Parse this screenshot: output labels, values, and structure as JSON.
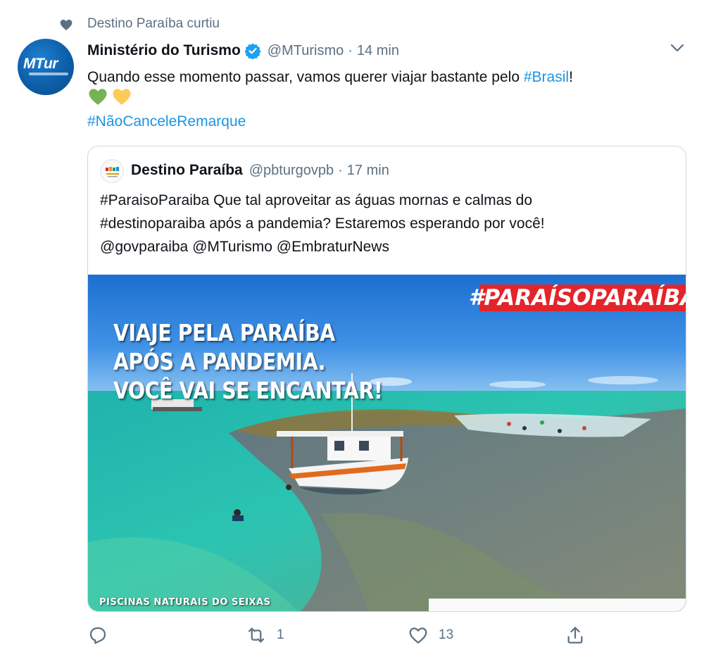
{
  "social_context": {
    "text": "Destino Paraíba curtiu",
    "icon": "heart-icon"
  },
  "tweet": {
    "author_name": "Ministério do Turismo",
    "verified": true,
    "handle": "@MTurismo",
    "separator": "·",
    "time": "14 min",
    "avatar_logo": "MTur",
    "text_prefix": "Quando esse momento passar, vamos querer viajar bastante pelo ",
    "text_link": "#Brasil",
    "text_suffix": "!",
    "emojis": [
      "green-heart",
      "yellow-heart"
    ],
    "hashtag": "#NãoCanceleRemarque"
  },
  "quote": {
    "author_name": "Destino Paraíba",
    "handle": "@pbturgovpb",
    "separator": "·",
    "time": "17 min",
    "text_line1": "#ParaisoParaiba Que tal aproveitar as águas mornas e calmas do",
    "text_line2": "#destinoparaiba após a pandemia? Estaremos esperando por você!",
    "text_line3": "@govparaiba @MTurismo @EmbraturNews",
    "media": {
      "banner": "#PARAÍSOPARAÍBA",
      "headline_line1": "VIAJE PELA PARAÍBA",
      "headline_line2": "APÓS A PANDEMIA.",
      "headline_line3": "VOCÊ VAI SE ENCANTAR!",
      "caption": "PISCINAS NATURAIS DO SEIXAS",
      "banner_color": "#e3242b"
    }
  },
  "actions": {
    "reply_count": "",
    "retweet_count": "1",
    "like_count": "13",
    "share_count": ""
  },
  "colors": {
    "link": "#1b95e0",
    "secondary": "#5b7083",
    "verified": "#1da1f2"
  }
}
